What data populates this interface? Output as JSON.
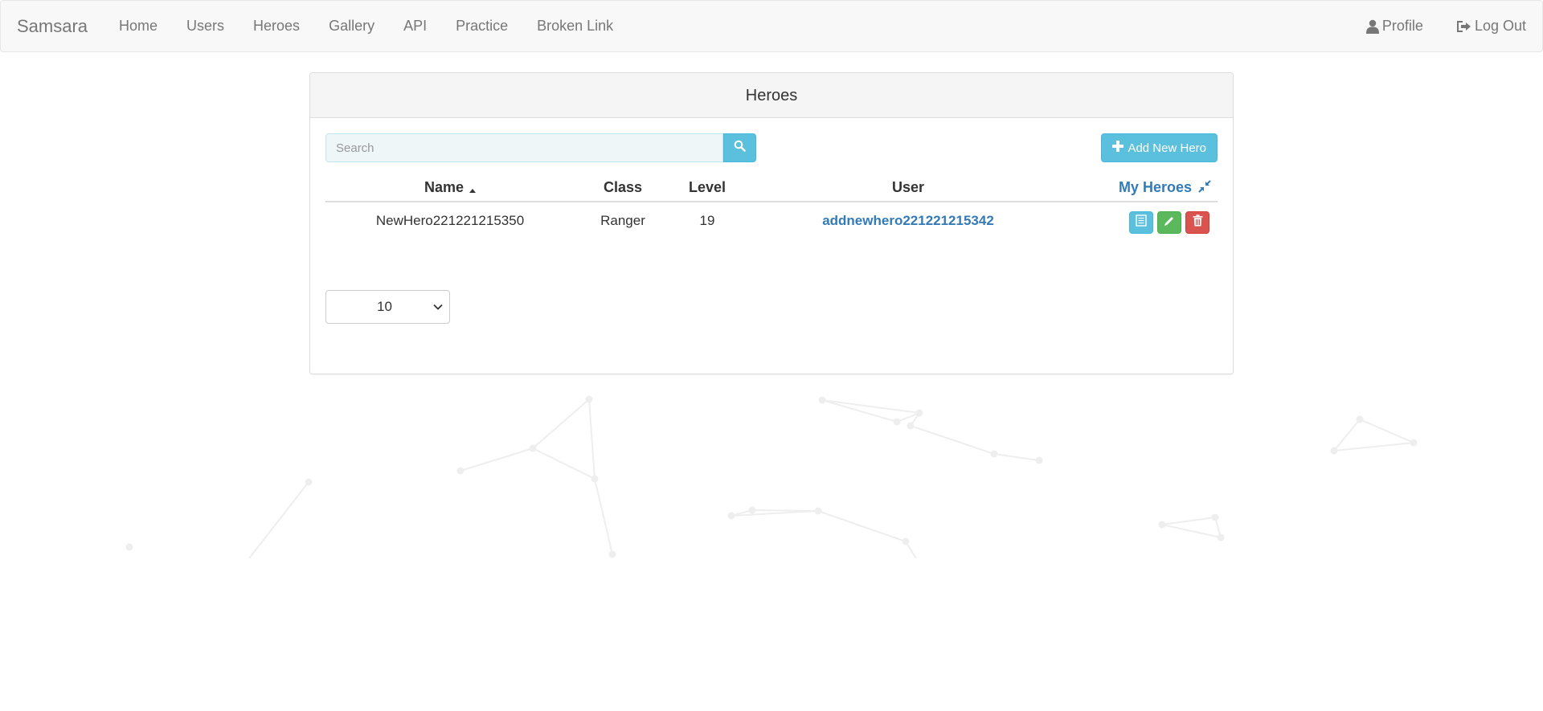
{
  "navbar": {
    "brand": "Samsara",
    "items": [
      "Home",
      "Users",
      "Heroes",
      "Gallery",
      "API",
      "Practice",
      "Broken Link"
    ],
    "profile_label": "Profile",
    "logout_label": "Log Out",
    "profile_icon": "user-icon",
    "logout_icon": "log-out-icon"
  },
  "panel": {
    "title": "Heroes",
    "search_placeholder": "Search",
    "search_icon": "search-icon",
    "add_button_label": "Add New Hero",
    "add_button_icon": "plus-icon"
  },
  "table": {
    "columns": {
      "name": "Name",
      "class": "Class",
      "level": "Level",
      "user": "User",
      "my_heroes": "My Heroes"
    },
    "sort": "name-ascending",
    "rows": [
      {
        "name": "NewHero221221215350",
        "class": "Ranger",
        "level": "19",
        "user": "addnewhero221221215342"
      }
    ]
  },
  "pagination": {
    "page_size": "10"
  },
  "colors": {
    "info": "#5bc0de",
    "success": "#5cb85c",
    "danger": "#d9534f",
    "link": "#337ab7"
  }
}
